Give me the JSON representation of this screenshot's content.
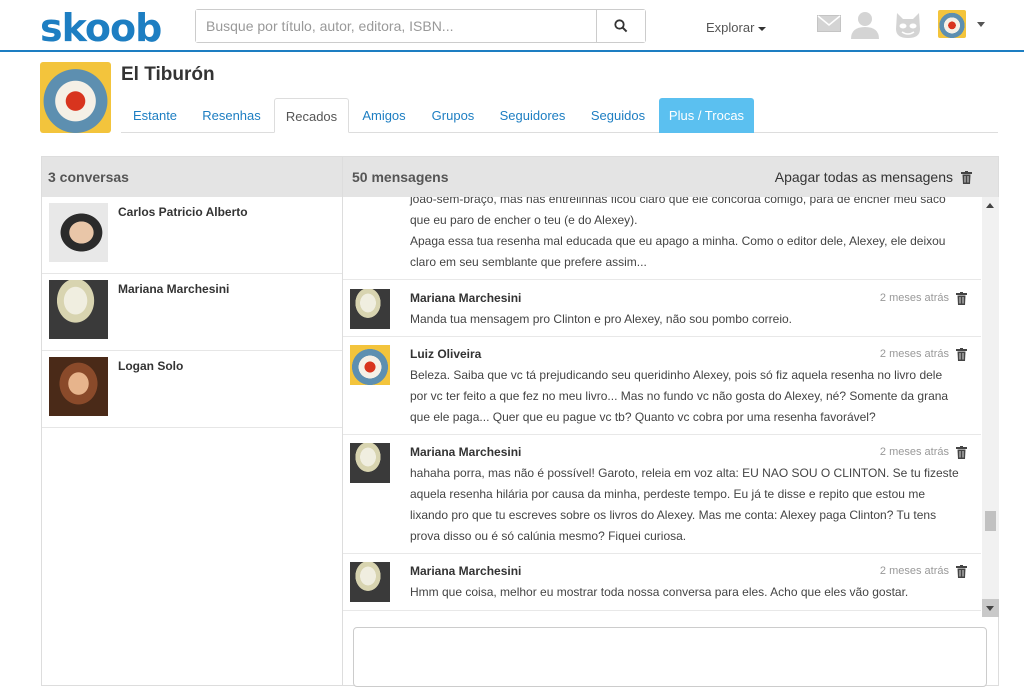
{
  "app": {
    "logo": "skoob"
  },
  "search": {
    "placeholder": "Busque por título, autor, editora, ISBN..."
  },
  "nav": {
    "explore_label": "Explorar"
  },
  "profile": {
    "name": "El Tiburón"
  },
  "tabs": [
    {
      "label": "Estante"
    },
    {
      "label": "Resenhas"
    },
    {
      "label": "Recados"
    },
    {
      "label": "Amigos"
    },
    {
      "label": "Grupos"
    },
    {
      "label": "Seguidores"
    },
    {
      "label": "Seguidos"
    },
    {
      "label": "Plus / Trocas"
    }
  ],
  "active_tab": "Recados",
  "conversations": {
    "header": "3 conversas",
    "items": [
      {
        "name": "Carlos Patricio Alberto"
      },
      {
        "name": "Mariana Marchesini"
      },
      {
        "name": "Logan Solo"
      }
    ]
  },
  "messages": {
    "header": "50 mensagens",
    "clear_all_label": "Apagar todas as mensagens",
    "items": [
      {
        "author": "",
        "time": "",
        "lines": [
          "joão-sem-braço, mas nas entrelinhas ficou claro que ele concorda comigo, para de encher meu saco",
          "que eu paro de encher o teu (e do Alexey).",
          "Apaga essa tua resenha mal educada que eu apago a minha. Como o editor dele, Alexey, ele deixou",
          "claro em seu semblante que prefere assim..."
        ]
      },
      {
        "author": "Mariana Marchesini",
        "time": "2 meses atrás",
        "lines": [
          "Manda tua mensagem pro Clinton e pro Alexey, não sou pombo correio."
        ]
      },
      {
        "author": "Luiz Oliveira",
        "time": "2 meses atrás",
        "lines": [
          "Beleza. Saiba que vc tá prejudicando seu queridinho Alexey, pois só fiz aquela resenha no livro dele",
          "por vc ter feito a que fez no meu livro... Mas no fundo vc não gosta do Alexey, né? Somente da grana",
          "que ele paga... Quer que eu pague vc tb? Quanto vc cobra por uma resenha favorável?"
        ]
      },
      {
        "author": "Mariana Marchesini",
        "time": "2 meses atrás",
        "lines": [
          "hahaha porra, mas não é possível! Garoto, releia em voz alta: EU NAO SOU O CLINTON. Se tu fizeste",
          "aquela resenha hilária por causa da minha, perdeste tempo. Eu já te disse e repito que estou me",
          "lixando pro que tu escreves sobre os livros do Alexey. Mas me conta: Alexey paga Clinton? Tu tens",
          "prova disso ou é só calúnia mesmo? Fiquei curiosa."
        ]
      },
      {
        "author": "Mariana Marchesini",
        "time": "2 meses atrás",
        "lines": [
          "Hmm que coisa, melhor eu mostrar toda nossa conversa para eles. Acho que eles vão gostar."
        ]
      }
    ]
  },
  "colors": {
    "brand": "#1d7ec2",
    "plus_tab": "#5bc0f0",
    "panel_header": "#e4e4e4"
  },
  "icons": [
    "search-icon",
    "mail-icon",
    "user-icon",
    "cat-mask-icon",
    "trash-icon",
    "chevron-down-icon"
  ]
}
